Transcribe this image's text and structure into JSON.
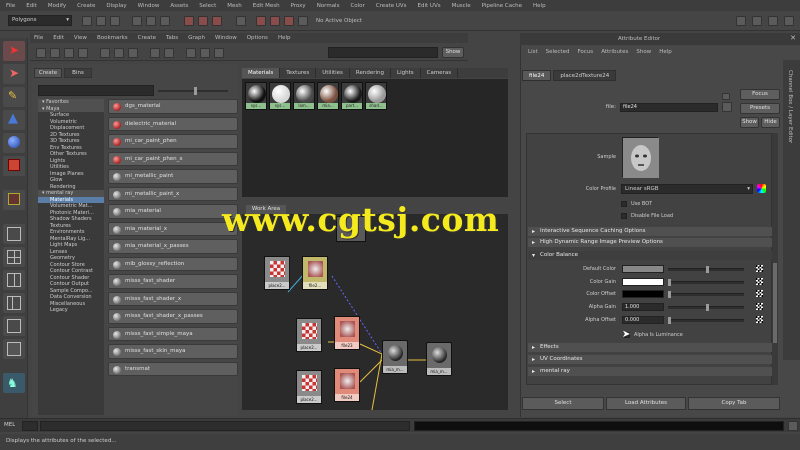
{
  "menubar": [
    "File",
    "Edit",
    "Modify",
    "Create",
    "Display",
    "Window",
    "Assets",
    "Select",
    "Mesh",
    "Edit Mesh",
    "Proxy",
    "Normals",
    "Color",
    "Create UVs",
    "Edit UVs",
    "Muscle",
    "Pipeline Cache",
    "Help"
  ],
  "status": {
    "mode": "Polygons",
    "selection_hint": "No Active Object"
  },
  "hypershade": {
    "menu": [
      "File",
      "Edit",
      "View",
      "Bookmarks",
      "Create",
      "Tabs",
      "Graph",
      "Window",
      "Options",
      "Help"
    ],
    "search_label": "Show",
    "left_tabs": [
      "Create",
      "Bins"
    ],
    "tree": [
      {
        "label": "Favorites",
        "type": "head"
      },
      {
        "label": "Maya",
        "type": "head"
      },
      {
        "label": "Surface",
        "type": "item"
      },
      {
        "label": "Volumetric",
        "type": "item"
      },
      {
        "label": "Displacement",
        "type": "item"
      },
      {
        "label": "2D Textures",
        "type": "item"
      },
      {
        "label": "3D Textures",
        "type": "item"
      },
      {
        "label": "Env Textures",
        "type": "item"
      },
      {
        "label": "Other Textures",
        "type": "item"
      },
      {
        "label": "Lights",
        "type": "item"
      },
      {
        "label": "Utilities",
        "type": "item"
      },
      {
        "label": "Image Planes",
        "type": "item"
      },
      {
        "label": "Glow",
        "type": "item"
      },
      {
        "label": "Rendering",
        "type": "item"
      },
      {
        "label": "mental ray",
        "type": "head"
      },
      {
        "label": "Materials",
        "type": "sel"
      },
      {
        "label": "Volumetric Mat...",
        "type": "item"
      },
      {
        "label": "Photonic Materi...",
        "type": "item"
      },
      {
        "label": "Shadow Shaders",
        "type": "item"
      },
      {
        "label": "Textures",
        "type": "item"
      },
      {
        "label": "Environments",
        "type": "item"
      },
      {
        "label": "MentalRay Lig...",
        "type": "item"
      },
      {
        "label": "Light Maps",
        "type": "item"
      },
      {
        "label": "Lenses",
        "type": "item"
      },
      {
        "label": "Geometry",
        "type": "item"
      },
      {
        "label": "Contour Store",
        "type": "item"
      },
      {
        "label": "Contour Contrast",
        "type": "item"
      },
      {
        "label": "Contour Shader",
        "type": "item"
      },
      {
        "label": "Contour Output",
        "type": "item"
      },
      {
        "label": "Sample Compo...",
        "type": "item"
      },
      {
        "label": "Data Conversion",
        "type": "item"
      },
      {
        "label": "Miscellaneous",
        "type": "item"
      },
      {
        "label": "Legacy",
        "type": "item"
      }
    ],
    "nodes": [
      {
        "label": "dgs_material",
        "style": "red"
      },
      {
        "label": "dielectric_material",
        "style": "red"
      },
      {
        "label": "mi_car_paint_phen",
        "style": "red"
      },
      {
        "label": "mi_car_paint_phen_x",
        "style": "red"
      },
      {
        "label": "mi_metallic_paint",
        "style": "gray"
      },
      {
        "label": "mi_metallic_paint_x",
        "style": "gray"
      },
      {
        "label": "mia_material",
        "style": "gray"
      },
      {
        "label": "mia_material_x",
        "style": "gray"
      },
      {
        "label": "mia_material_x_passes",
        "style": "gray"
      },
      {
        "label": "mib_glossy_reflection",
        "style": "gray"
      },
      {
        "label": "misss_fast_shader",
        "style": "gray"
      },
      {
        "label": "misss_fast_shader_x",
        "style": "gray"
      },
      {
        "label": "misss_fast_shader_x_passes",
        "style": "gray"
      },
      {
        "label": "misss_fast_simple_maya",
        "style": "gray"
      },
      {
        "label": "misss_fast_skin_maya",
        "style": "gray"
      },
      {
        "label": "transmat",
        "style": "gray"
      }
    ],
    "material_tabs": [
      "Materials",
      "Textures",
      "Utilities",
      "Rendering",
      "Lights",
      "Cameras"
    ],
    "swatches": [
      {
        "label": "sys...",
        "ball": "#111111"
      },
      {
        "label": "sys...",
        "ball": "#d8d8d8"
      },
      {
        "label": "lam...",
        "ball": "#4a4a4a"
      },
      {
        "label": "mia...",
        "ball": "#7a5040"
      },
      {
        "label": "part...",
        "ball": "#1a1a1a"
      },
      {
        "label": "shad...",
        "ball": "#9a9a9a"
      }
    ],
    "work_tab": "Work Area",
    "graph_nodes": [
      {
        "label": "place2...",
        "color": "#8a8a8a"
      },
      {
        "label": "file2...",
        "color": "#c2b86a"
      },
      {
        "label": "place2...",
        "color": "#8a8a8a"
      },
      {
        "label": "file23",
        "color": "#e08a7a"
      },
      {
        "label": "place2...",
        "color": "#8a8a8a"
      },
      {
        "label": "file24",
        "color": "#e08a7a"
      },
      {
        "label": "mia_m...",
        "color": "#6a6a6a"
      },
      {
        "label": "mia_m...",
        "color": "#6a6a6a"
      }
    ]
  },
  "attribute_editor": {
    "title": "Attribute Editor",
    "menu": [
      "List",
      "Selected",
      "Focus",
      "Attributes",
      "Show",
      "Help"
    ],
    "tabs": [
      "file24",
      "place2dTexture24"
    ],
    "file_label": "file:",
    "file_value": "file24",
    "buttons": {
      "focus": "Focus",
      "presets": "Presets",
      "show": "Show",
      "hide": "Hide"
    },
    "sample_label": "Sample",
    "color_profile_label": "Color Profile",
    "color_profile_value": "Linear sRGB",
    "check_use_bot": "Use BOT",
    "check_disable_file_load": "Disable File Load",
    "sections": [
      {
        "label": "Interactive Sequence Caching Options",
        "open": false
      },
      {
        "label": "High Dynamic Range Image Preview Options",
        "open": false
      },
      {
        "label": "Color Balance",
        "open": true
      }
    ],
    "color_balance": [
      {
        "label": "Default Color",
        "type": "color",
        "color": "#888888"
      },
      {
        "label": "Color Gain",
        "type": "color",
        "color": "#ffffff"
      },
      {
        "label": "Color Offset",
        "type": "color",
        "color": "#000000"
      },
      {
        "label": "Alpha Gain",
        "type": "number",
        "value": "1.000"
      },
      {
        "label": "Alpha Offset",
        "type": "number",
        "value": "0.000"
      }
    ],
    "alpha_luminance": "Alpha Is Luminance",
    "bottom_sections": [
      "Effects",
      "UV Coordinates",
      "mental ray"
    ],
    "bottom_buttons": [
      "Select",
      "Load Attributes",
      "Copy Tab"
    ],
    "side_tab": "Channel Box / Layer Editor"
  },
  "command_line": {
    "mel_label": "MEL"
  },
  "help_line": "Displays the attributes of the selected...",
  "watermark": "www.cgtsj.com",
  "colors": {
    "panel": "#444444",
    "dark": "#262626",
    "selection": "#5a7ea8",
    "watermark": "#f5ea1e"
  }
}
